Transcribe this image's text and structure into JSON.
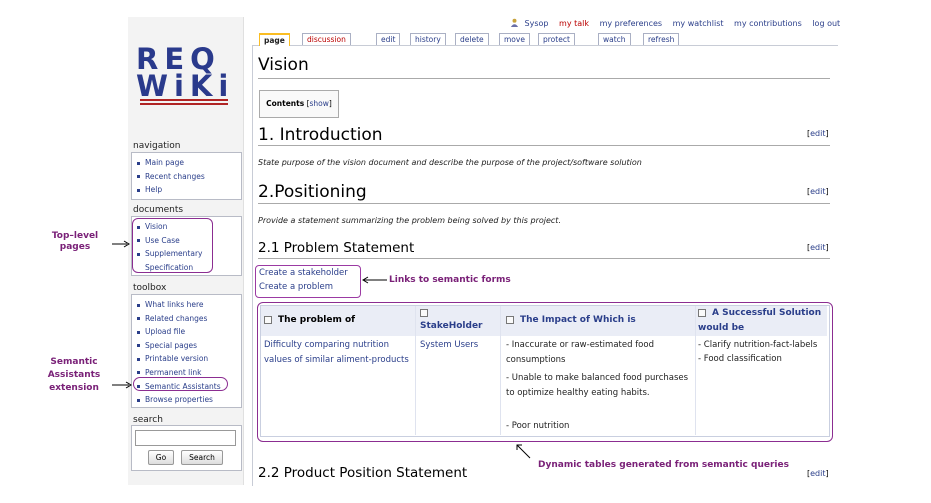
{
  "logo": {
    "line1": "REQ",
    "line2": "WiKi"
  },
  "topbar": {
    "user": "Sysop",
    "talk": "my talk",
    "preferences": "my preferences",
    "watchlist": "my watchlist",
    "contributions": "my contributions",
    "logout": "log out"
  },
  "tabs": [
    "page",
    "discussion",
    "edit",
    "history",
    "delete",
    "move",
    "protect",
    "watch",
    "refresh"
  ],
  "sidebar": {
    "navigation": {
      "title": "navigation",
      "items": [
        "Main page",
        "Recent changes",
        "Help"
      ]
    },
    "documents": {
      "title": "documents",
      "items": [
        "Vision",
        "Use Case",
        "Supplementary",
        "Specification"
      ]
    },
    "toolbox": {
      "title": "toolbox",
      "items": [
        "What links here",
        "Related changes",
        "Upload file",
        "Special pages",
        "Printable version",
        "Permanent link",
        "Semantic Assistants",
        "Browse properties"
      ]
    },
    "search": {
      "title": "search",
      "go": "Go",
      "search": "Search"
    }
  },
  "page": {
    "title": "Vision",
    "toc": {
      "label": "Contents",
      "show": "show"
    },
    "edit_label": "edit",
    "sections": {
      "intro": {
        "heading": "1. Introduction",
        "text": "State purpose of the vision document and describe the purpose of the project/software solution"
      },
      "positioning": {
        "heading": "2.Positioning",
        "text": "Provide a statement summarizing the problem being solved by this project."
      },
      "problem": {
        "heading": "2.1 Problem Statement"
      },
      "product": {
        "heading": "2.2 Product Position Statement"
      }
    },
    "forms": {
      "stakeholder": "Create a stakeholder",
      "problem": "Create a problem"
    },
    "table": {
      "headers": [
        "The problem of",
        "StakeHolder",
        "The Impact of Which is",
        "A Successful Solution would be"
      ],
      "problem": "Difficulty comparing nutrition values of similar aliment-products",
      "stakeholder": "System Users",
      "impacts": [
        "- Inaccurate or raw-estimated food consumptions",
        "- Unable to make balanced food purchases to optimize healthy eating habits.",
        "- Poor nutrition"
      ],
      "solutions": [
        "- Clarify nutrition-fact-labels",
        "- Food classification"
      ]
    }
  },
  "annotations": {
    "top_level": "Top–level\npages",
    "semantic": "Semantic\nAssistants\nextension",
    "links": "Links to semantic forms",
    "dynamic": "Dynamic tables generated from semantic queries"
  },
  "colors": {
    "link": "#2a3e8a",
    "annotation": "#7a2178",
    "logo": "#2a3a8c",
    "tab_selected": "#fabd23"
  }
}
